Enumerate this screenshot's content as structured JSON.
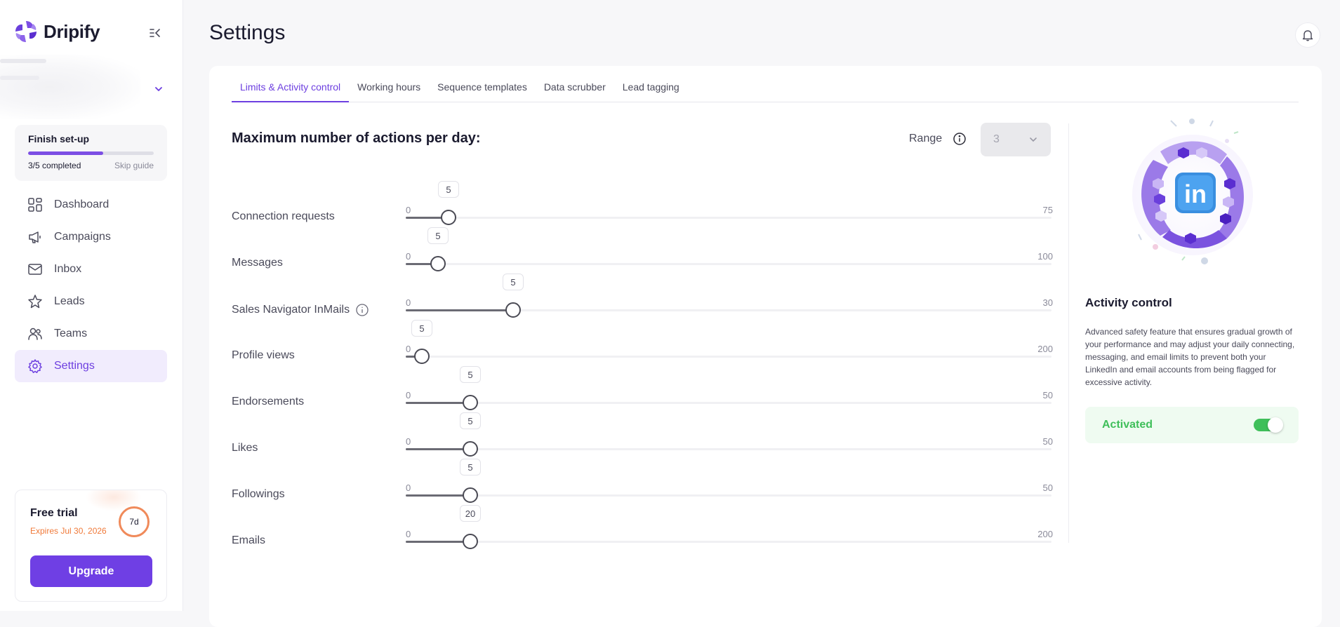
{
  "app": {
    "name": "Dripify"
  },
  "setup": {
    "title": "Finish set-up",
    "completed": 3,
    "total": 5,
    "count_label": "3/5 completed",
    "skip_label": "Skip guide"
  },
  "nav": [
    {
      "label": "Dashboard",
      "icon": "grid-icon",
      "active": false
    },
    {
      "label": "Campaigns",
      "icon": "megaphone-icon",
      "active": false
    },
    {
      "label": "Inbox",
      "icon": "mail-icon",
      "active": false
    },
    {
      "label": "Leads",
      "icon": "star-icon",
      "active": false
    },
    {
      "label": "Teams",
      "icon": "users-icon",
      "active": false
    },
    {
      "label": "Settings",
      "icon": "gear-icon",
      "active": true
    }
  ],
  "trial": {
    "title": "Free trial",
    "expires": "Expires Jul 30, 2026",
    "days_left": "7d",
    "upgrade_label": "Upgrade"
  },
  "page": {
    "title": "Settings"
  },
  "tabs": [
    {
      "label": "Limits & Activity control",
      "active": true
    },
    {
      "label": "Working hours",
      "active": false
    },
    {
      "label": "Sequence templates",
      "active": false
    },
    {
      "label": "Data scrubber",
      "active": false
    },
    {
      "label": "Lead tagging",
      "active": false
    }
  ],
  "limits": {
    "title": "Maximum number of actions per day:",
    "range_label": "Range",
    "range_value": "3",
    "sliders": [
      {
        "label": "Connection requests",
        "min": 0,
        "max": 75,
        "value": 5,
        "info": false
      },
      {
        "label": "Messages",
        "min": 0,
        "max": 100,
        "value": 5,
        "info": false
      },
      {
        "label": "Sales Navigator InMails",
        "min": 0,
        "max": 30,
        "value": 5,
        "info": true
      },
      {
        "label": "Profile views",
        "min": 0,
        "max": 200,
        "value": 5,
        "info": false
      },
      {
        "label": "Endorsements",
        "min": 0,
        "max": 50,
        "value": 5,
        "info": false
      },
      {
        "label": "Likes",
        "min": 0,
        "max": 50,
        "value": 5,
        "info": false
      },
      {
        "label": "Followings",
        "min": 0,
        "max": 50,
        "value": 5,
        "info": false
      },
      {
        "label": "Emails",
        "min": 0,
        "max": 200,
        "value": 20,
        "info": false
      }
    ]
  },
  "activity": {
    "title": "Activity control",
    "description": "Advanced safety feature that ensures gradual growth of your performance and may adjust your daily connecting, messaging, and email limits to prevent both your LinkedIn and email accounts from being flagged for excessive activity.",
    "status_label": "Activated",
    "enabled": true
  },
  "colors": {
    "accent": "#6f3fe4",
    "active_bg": "#f1ecfd",
    "success": "#3fbf5a",
    "warning": "#f07a3a"
  }
}
